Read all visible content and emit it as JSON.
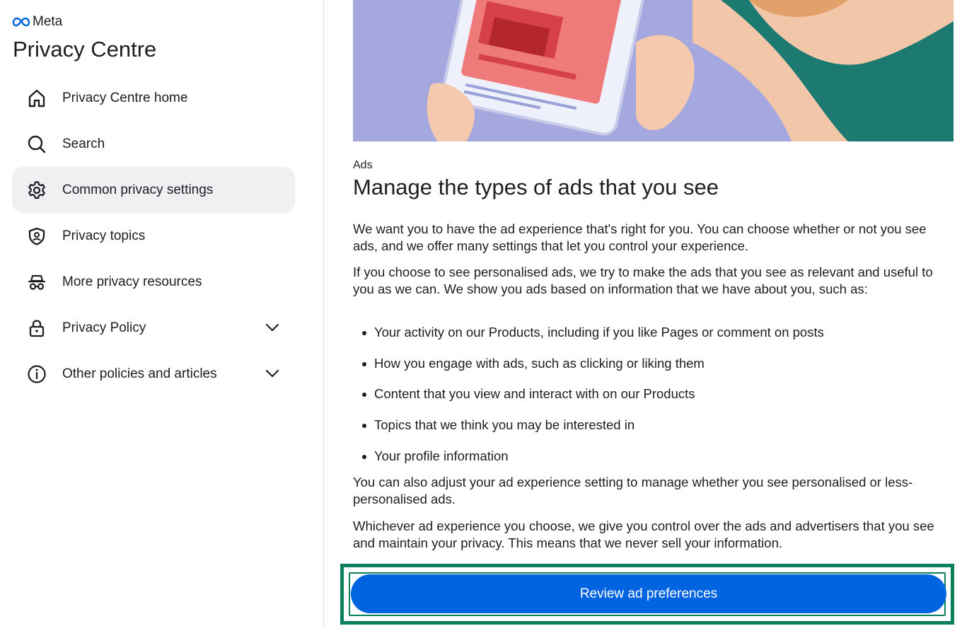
{
  "brand": {
    "name": "Meta"
  },
  "sidebar": {
    "title": "Privacy Centre",
    "items": [
      {
        "label": "Privacy Centre home",
        "icon": "home-icon"
      },
      {
        "label": "Search",
        "icon": "search-icon"
      },
      {
        "label": "Common privacy settings",
        "icon": "gear-icon",
        "active": true
      },
      {
        "label": "Privacy topics",
        "icon": "shield-icon"
      },
      {
        "label": "More privacy resources",
        "icon": "incognito-icon"
      },
      {
        "label": "Privacy Policy",
        "icon": "lock-icon",
        "expandable": true
      },
      {
        "label": "Other policies and articles",
        "icon": "info-icon",
        "expandable": true
      }
    ]
  },
  "main": {
    "hero_image": "illustration of hands holding a tablet showing a red armchair",
    "category": "Ads",
    "headline": "Manage the types of ads that you see",
    "paragraphs": [
      "We want you to have the ad experience that's right for you. You can choose whether or not you see ads, and we offer many settings that let you control your experience.",
      "If you choose to see personalised ads, we try to make the ads that you see as relevant and useful to you as we can. We show you ads based on information that we have about you, such as:",
      "You can also adjust your ad experience setting to manage whether you see personalised or less-personalised ads.",
      "Whichever ad experience you choose, we give you control over the ads and advertisers that you see and maintain your privacy. This means that we never sell your information."
    ],
    "bullets": [
      "Your activity on our Products, including if you like Pages or comment on posts",
      "How you engage with ads, such as clicking or liking them",
      "Content that you view and interact with on our Products",
      "Topics that we think you may be interested in",
      "Your profile information"
    ],
    "cta_label": "Review ad preferences"
  },
  "colors": {
    "accent": "#0064e0",
    "highlight_frame": "#0a7f5e",
    "active_nav_bg": "#f0f0f2",
    "hero_bg": "#a5a8de"
  }
}
